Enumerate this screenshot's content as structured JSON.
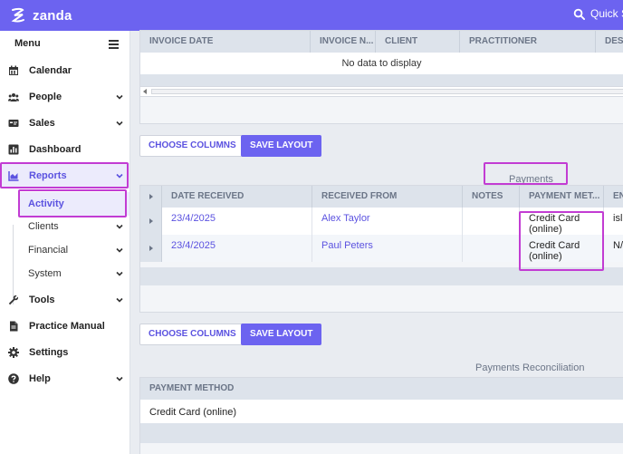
{
  "app": {
    "brand": "zanda",
    "quick_search": "Quick S"
  },
  "colors": {
    "accent": "#6c63f0",
    "highlight": "#c23cd3",
    "link": "#5b52e0"
  },
  "sidebar": {
    "title": "Menu",
    "items": [
      {
        "label": "Calendar",
        "icon": "calendar-icon"
      },
      {
        "label": "People",
        "icon": "people-icon"
      },
      {
        "label": "Sales",
        "icon": "sales-icon"
      },
      {
        "label": "Dashboard",
        "icon": "dashboard-icon"
      },
      {
        "label": "Reports",
        "icon": "reports-icon"
      },
      {
        "label": "Tools",
        "icon": "wrench-icon"
      },
      {
        "label": "Practice Manual",
        "icon": "document-icon"
      },
      {
        "label": "Settings",
        "icon": "gear-icon"
      },
      {
        "label": "Help",
        "icon": "help-icon"
      }
    ],
    "reports_sub": [
      {
        "label": "Activity"
      },
      {
        "label": "Clients"
      },
      {
        "label": "Financial"
      },
      {
        "label": "System"
      }
    ]
  },
  "invoices": {
    "columns": [
      "INVOICE DATE",
      "INVOICE N...",
      "CLIENT",
      "PRACTITIONER",
      "DESC"
    ],
    "empty_text": "No data to display"
  },
  "toolbar1": {
    "choose_columns": "CHOOSE COLUMNS",
    "save_layout": "SAVE LAYOUT"
  },
  "payments": {
    "title": "Payments",
    "columns": [
      "DATE RECEIVED",
      "RECEIVED FROM",
      "NOTES",
      "PAYMENT MET...",
      "EN"
    ],
    "rows": [
      {
        "date": "23/4/2025",
        "from": "Alex Taylor",
        "notes": "",
        "method": "Credit Card (online)",
        "extra": "isl"
      },
      {
        "date": "23/4/2025",
        "from": "Paul Peters",
        "notes": "",
        "method": "Credit Card (online)",
        "extra": "N/"
      }
    ]
  },
  "toolbar2": {
    "choose_columns": "CHOOSE COLUMNS",
    "save_layout": "SAVE LAYOUT"
  },
  "reconciliation": {
    "title": "Payments Reconciliation",
    "columns": [
      "PAYMENT METHOD"
    ],
    "rows": [
      {
        "method": "Credit Card (online)"
      }
    ]
  }
}
